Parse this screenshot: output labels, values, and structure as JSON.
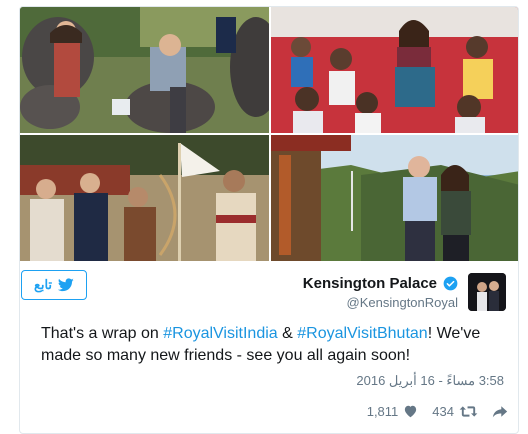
{
  "tweet": {
    "display_name": "Kensington Palace",
    "handle": "@KensingtonRoyal",
    "follow_label": "تابع",
    "text_parts": {
      "t1": "That's a wrap on ",
      "h1": "#RoyalVisitIndia",
      "t2": " & ",
      "h2": "#RoyalVisitBhutan",
      "t3": "! We've made so many new friends - see you all again soon!"
    },
    "timestamp": "3:58 مساءً - 16 أبريل 2016",
    "likes": "1,811",
    "retweets": "434"
  },
  "colors": {
    "brand_blue": "#1da1f2",
    "hashtag_blue": "#1b95e0",
    "muted": "#657786"
  },
  "icons": [
    "verified-badge-icon",
    "twitter-bird-icon",
    "heart-icon",
    "retweet-icon",
    "share-arrow-icon"
  ]
}
